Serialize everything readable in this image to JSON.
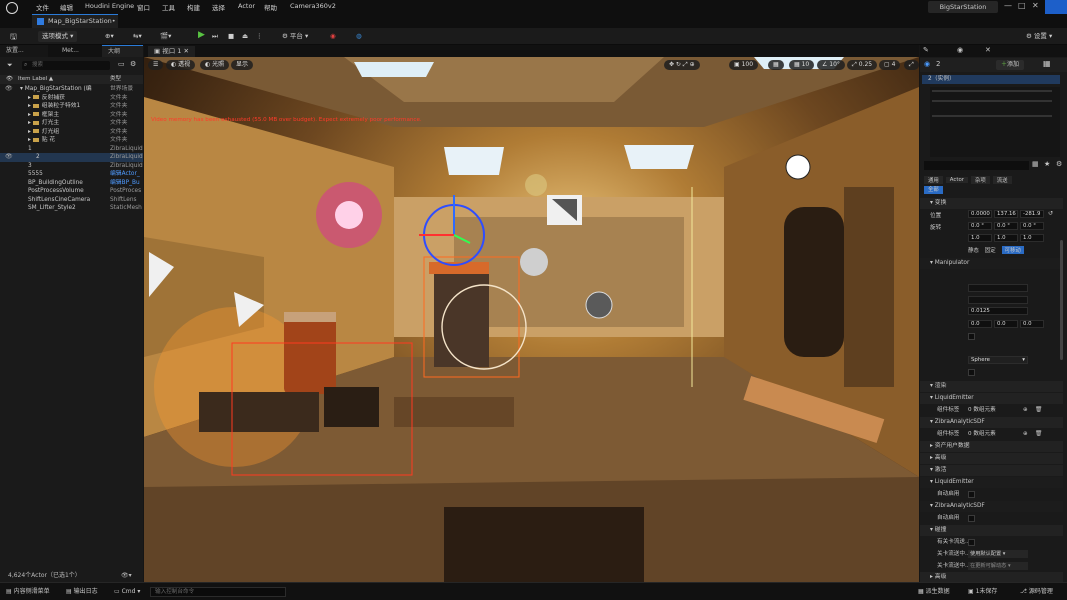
{
  "menubar": {
    "items": [
      "文件",
      "编辑",
      "Houdini Engine",
      "窗口",
      "工具",
      "构建",
      "选择",
      "Actor",
      "帮助",
      "Camera360v2"
    ],
    "project_name": "BigStarStation"
  },
  "tabs": {
    "map_tab": "Map_BigStarStation•"
  },
  "toolbar": {
    "mode_label": "选项模式",
    "platform_label": "平台",
    "settings_label": "设置"
  },
  "left_panel": {
    "tabs": [
      "放置...",
      "Met...",
      "大纲"
    ],
    "search_placeholder": "搜索",
    "col_label": "Item Label ▲",
    "col_type": "类型",
    "rows": [
      {
        "name": "Map_BigStarStation (编",
        "type": "世界场景",
        "indent": 0,
        "folder": false,
        "selected": false
      },
      {
        "name": "反射捕获",
        "type": "文件夹",
        "indent": 1,
        "folder": true,
        "selected": false
      },
      {
        "name": "组装粒子特效1",
        "type": "文件夹",
        "indent": 1,
        "folder": true,
        "selected": false
      },
      {
        "name": "框架主",
        "type": "文件夹",
        "indent": 1,
        "folder": true,
        "selected": false
      },
      {
        "name": "灯光主",
        "type": "文件夹",
        "indent": 1,
        "folder": true,
        "selected": false
      },
      {
        "name": "灯光组",
        "type": "文件夹",
        "indent": 1,
        "folder": true,
        "selected": false
      },
      {
        "name": "贴 花",
        "type": "文件夹",
        "indent": 1,
        "folder": true,
        "selected": false
      },
      {
        "name": "1",
        "type": "ZibraLiquid",
        "indent": 1,
        "folder": false,
        "selected": false
      },
      {
        "name": "2",
        "type": "ZibraLiquid",
        "indent": 2,
        "folder": false,
        "selected": true
      },
      {
        "name": "3",
        "type": "ZibraLiquid",
        "indent": 1,
        "folder": false,
        "selected": false
      },
      {
        "name": "5555",
        "type": "编辑Actor_",
        "indent": 1,
        "folder": false,
        "selected": false
      },
      {
        "name": "BP_BuildingOutline",
        "type": "编辑BP_Bu",
        "indent": 1,
        "folder": false,
        "selected": false
      },
      {
        "name": "PostProcessVolume",
        "type": "PostProces",
        "indent": 1,
        "folder": false,
        "selected": false
      },
      {
        "name": "ShiftLensCineCamera",
        "type": "ShiftLens",
        "indent": 1,
        "folder": false,
        "selected": false
      },
      {
        "name": "SM_Lifter_Style2",
        "type": "StaticMesh",
        "indent": 1,
        "folder": false,
        "selected": false
      }
    ],
    "footer": "4,624个Actor（已选1个）"
  },
  "viewport": {
    "tab_label": "视口 1",
    "buttons": [
      "透视",
      "光照",
      "显示"
    ],
    "right_values": [
      "10",
      "10°",
      "0.25",
      "4"
    ],
    "cam_speed": "100",
    "warning": "Video memory has been exhausted (55.0 MB over budget). Expect extremely poor performance."
  },
  "right_panel": {
    "actor_name": "2",
    "add_label": "添加",
    "instance_label": "2（实例）",
    "filter_tabs": [
      "通用",
      "Actor",
      "杂项",
      "流送"
    ],
    "active_tab": "全部",
    "section_transform": "变换",
    "location_label": "位置",
    "location": [
      "0.0000",
      "137.16",
      "-281.9"
    ],
    "rotation_label": "旋转",
    "rotation": [
      "0.0 °",
      "0.0 °",
      "0.0 °"
    ],
    "scale": [
      "1.0",
      "1.0",
      "1.0"
    ],
    "mobility": [
      "静态",
      "固定",
      "可移动"
    ],
    "manipulator_label": "Manipulator",
    "speed_value": "0.0125",
    "vec_values": [
      "0.0",
      "0.0",
      "0.0"
    ],
    "shape_value": "Sphere",
    "sections": [
      {
        "label": "渲染"
      },
      {
        "label": "LiquidEmitter"
      },
      {
        "label": "ZibraAnalyticSDF"
      },
      {
        "label": "资产用户数据"
      },
      {
        "label": "高级"
      },
      {
        "label": "激活"
      },
      {
        "label": "LiquidEmitter"
      },
      {
        "label": "ZibraAnalyticSDF"
      },
      {
        "label": "碰撞"
      },
      {
        "label": "高级"
      }
    ],
    "component_label": "组件标签",
    "component_count": "0 数组元素",
    "auto_activate": "自动启用",
    "overlap_label": "有关卡流送...",
    "level_stream_1": "关卡流送中...",
    "level_stream_1_value": "使用默认配置",
    "level_stream_2": "关卡流送中...",
    "level_stream_2_value": "在更新可解动态"
  },
  "statusbar": {
    "content_drawer": "内容侧滑菜单",
    "output_log": "输出日志",
    "cmd_label": "Cmd",
    "cmd_placeholder": "输入控制台命令",
    "derived_data": "派生数据",
    "unsaved": "1未保存",
    "source_control": "源码管理"
  }
}
